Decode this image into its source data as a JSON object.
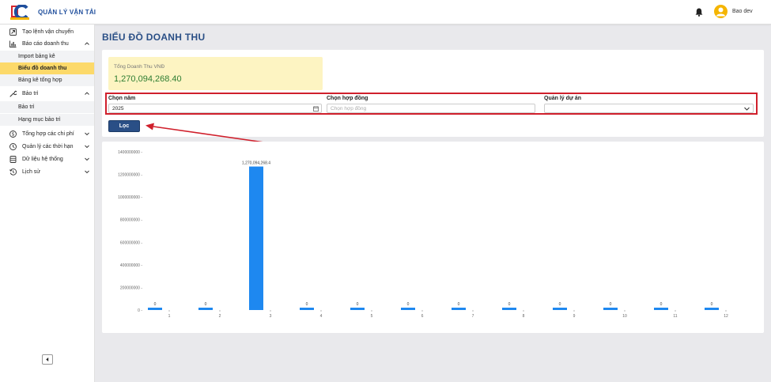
{
  "app": {
    "title": "QUẢN LÝ VẬN TẢI"
  },
  "header": {
    "user_name": "Bao dev"
  },
  "sidebar": {
    "items": [
      {
        "label": "Tạo lệnh vận chuyển",
        "icon": "route-icon"
      },
      {
        "label": "Báo cáo doanh thu",
        "icon": "bar-chart-icon",
        "expanded": true,
        "children": [
          "Import bảng kê",
          "Biểu đồ doanh thu",
          "Bảng kê tổng hợp"
        ],
        "active_child": "Biểu đồ doanh thu"
      },
      {
        "label": "Bảo trì",
        "icon": "wrench-icon",
        "expanded": true,
        "children": [
          "Bảo trì",
          "Hạng mục bảo trì"
        ]
      },
      {
        "label": "Tổng hợp các chi phí",
        "icon": "dollar-icon",
        "expanded": false
      },
      {
        "label": "Quản lý các thời hạn",
        "icon": "clock-icon",
        "expanded": false
      },
      {
        "label": "Dữ liệu hệ thống",
        "icon": "database-icon",
        "expanded": false
      },
      {
        "label": "Lịch sử",
        "icon": "history-icon",
        "expanded": false
      }
    ]
  },
  "page": {
    "title": "BIỂU ĐỒ DOANH THU",
    "total_label": "Tổng Doanh Thu VNĐ",
    "total_value": "1,270,094,268.40"
  },
  "filters": {
    "year_label": "Chọn năm",
    "year_value": "2025",
    "contract_label": "Chọn hợp đồng",
    "contract_placeholder": "Chọn hợp đồng",
    "project_label": "Quản lý dự án",
    "project_value": "",
    "filter_button": "Lọc"
  },
  "colors": {
    "accent": "#2a4f86",
    "bar": "#1e88f0",
    "highlight": "#d0202c",
    "active": "#fcd96a",
    "total_bg": "#fdf4c2",
    "total_text": "#2e7d32"
  },
  "chart_data": {
    "type": "bar",
    "categories": [
      "1",
      "2",
      "3",
      "4",
      "5",
      "6",
      "7",
      "8",
      "9",
      "10",
      "11",
      "12"
    ],
    "values": [
      0,
      0,
      1270094268.4,
      0,
      0,
      0,
      0,
      0,
      0,
      0,
      0,
      0
    ],
    "data_labels": [
      "0",
      "0",
      "1,270,094,268.4",
      "0",
      "0",
      "0",
      "0",
      "0",
      "0",
      "0",
      "0",
      "0"
    ],
    "yticks": [
      0,
      200000000,
      400000000,
      600000000,
      800000000,
      1000000000,
      1200000000,
      1400000000
    ],
    "ytick_labels": [
      "0 -",
      "200000000 -",
      "400000000 -",
      "600000000 -",
      "800000000 -",
      "1000000000 -",
      "1200000000 -",
      "1400000000 -"
    ],
    "ylim": [
      0,
      1400000000
    ],
    "title": "",
    "xlabel": "",
    "ylabel": "",
    "grid": false
  }
}
